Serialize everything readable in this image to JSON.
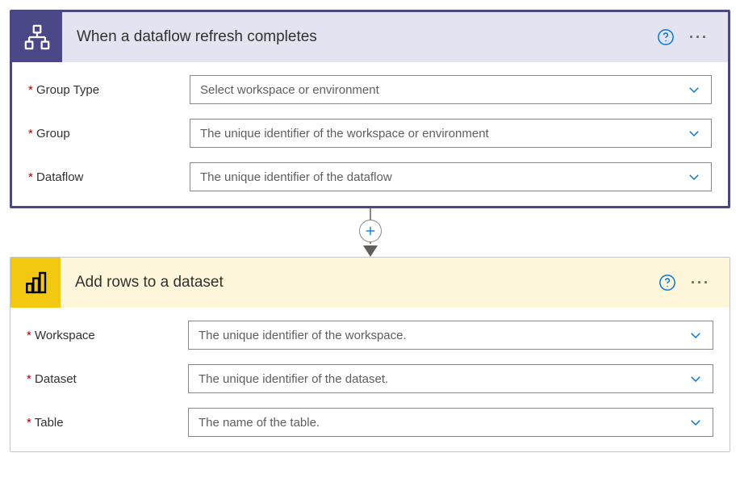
{
  "trigger": {
    "title": "When a dataflow refresh completes",
    "fields": [
      {
        "label": "Group Type",
        "placeholder": "Select workspace or environment"
      },
      {
        "label": "Group",
        "placeholder": "The unique identifier of the workspace or environment"
      },
      {
        "label": "Dataflow",
        "placeholder": "The unique identifier of the dataflow"
      }
    ]
  },
  "action": {
    "title": "Add rows to a dataset",
    "fields": [
      {
        "label": "Workspace",
        "placeholder": "The unique identifier of the workspace."
      },
      {
        "label": "Dataset",
        "placeholder": "The unique identifier of the dataset."
      },
      {
        "label": "Table",
        "placeholder": "The name of the table."
      }
    ]
  }
}
